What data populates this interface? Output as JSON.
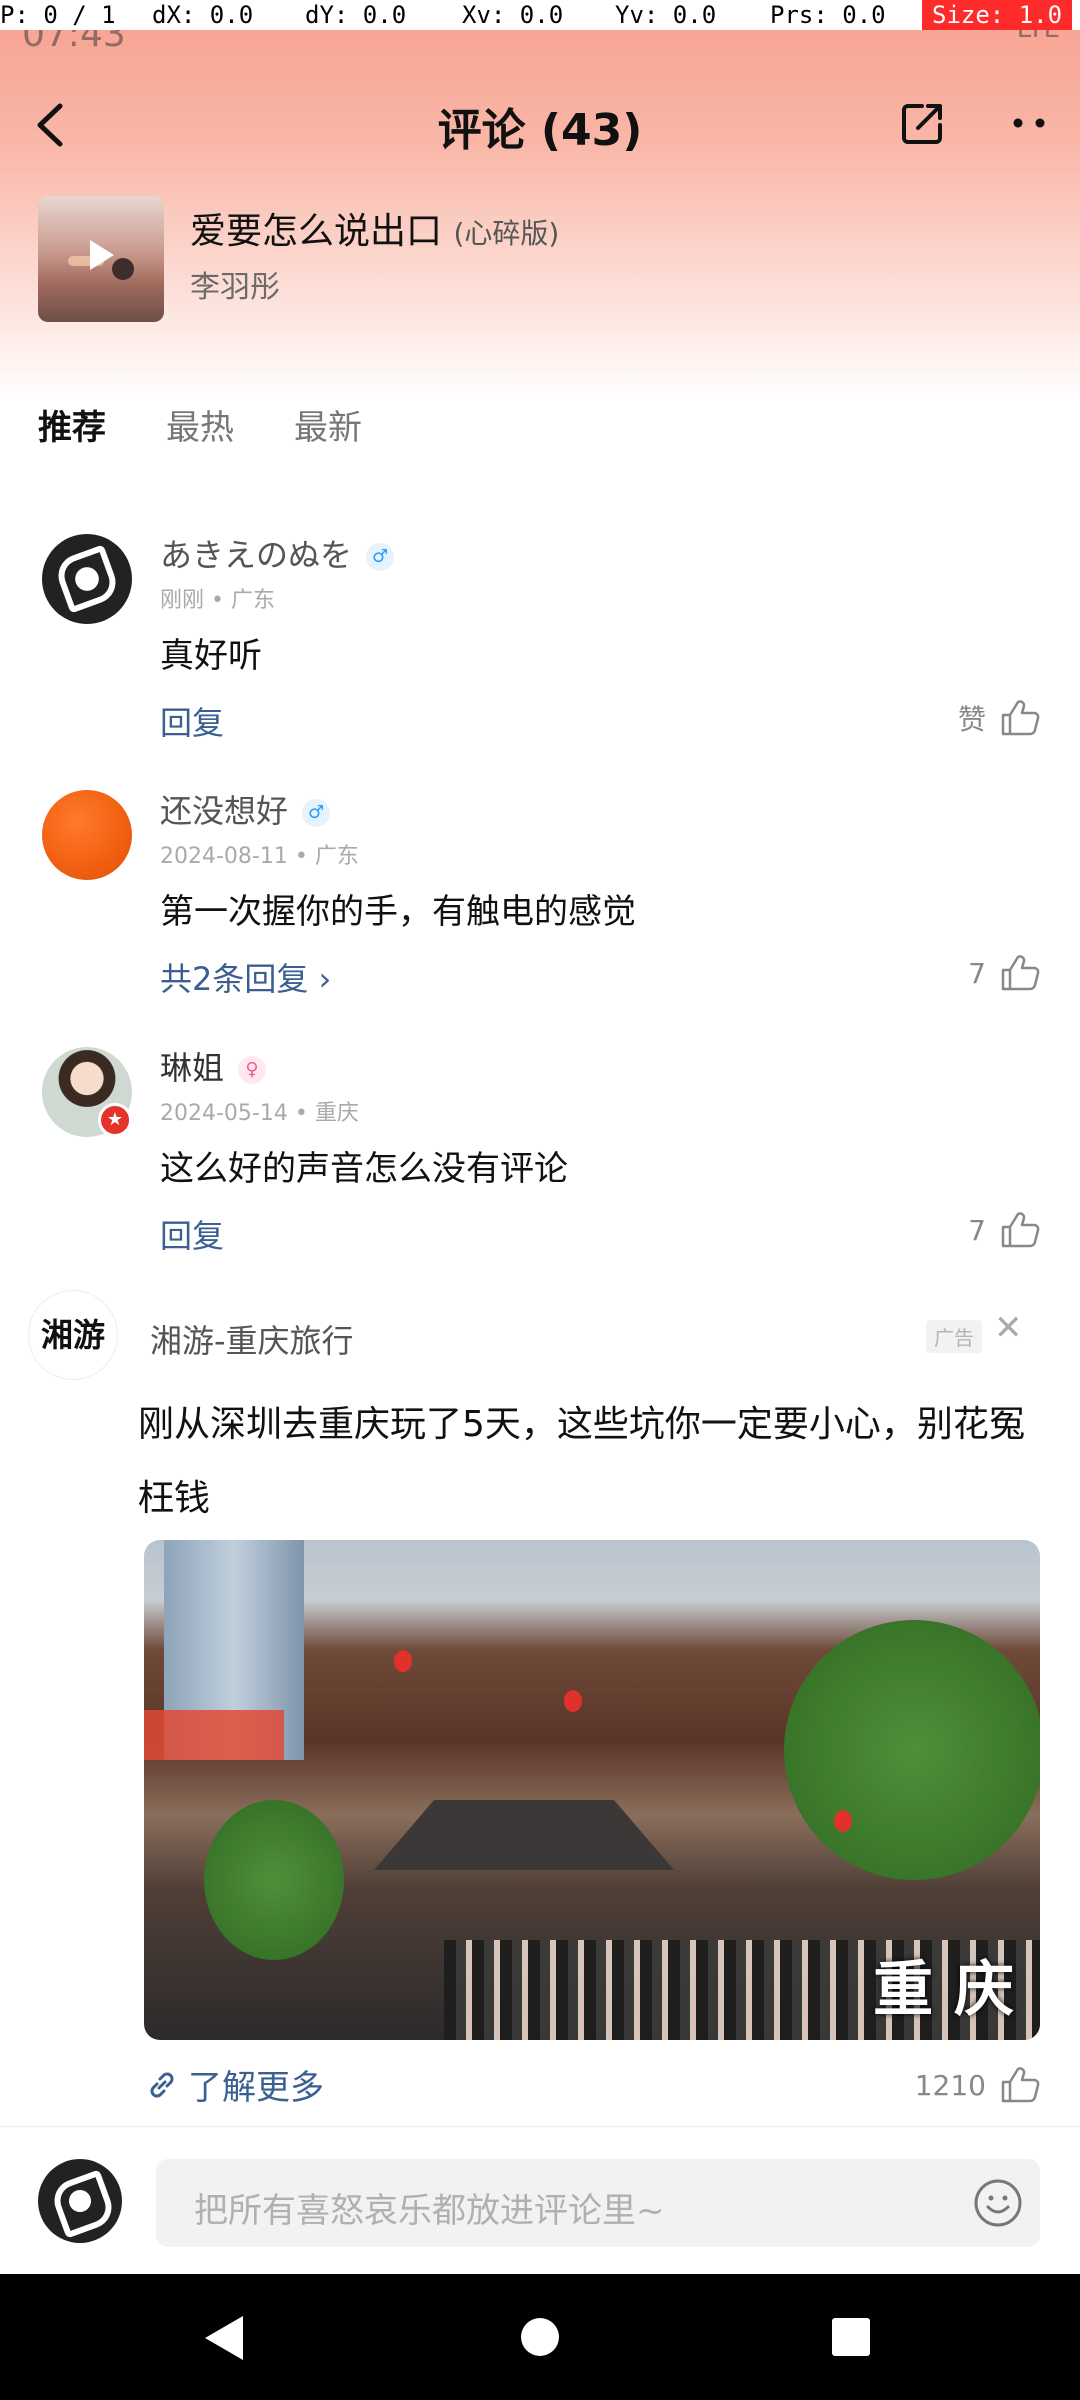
{
  "debug": {
    "p": "P: 0 / 1",
    "dx": "dX: 0.0",
    "dy": "dY: 0.0",
    "xv": "Xv: 0.0",
    "yv": "Yv: 0.0",
    "prs": "Prs: 0.0",
    "size": "Size: 1.0"
  },
  "status": {
    "time": "07:43",
    "network": "LTE"
  },
  "header": {
    "title": "评论 (43)"
  },
  "song": {
    "title": "爱要怎么说出口",
    "tag": "(心碎版)",
    "artist": "李羽彤"
  },
  "tabs": [
    "推荐",
    "最热",
    "最新"
  ],
  "comments": [
    {
      "user": "あきえのぬを",
      "gender": "♂",
      "meta": "刚刚 • 广东",
      "text": "真好听",
      "reply": "回复",
      "likes": "赞"
    },
    {
      "user": "还没想好",
      "gender": "♂",
      "meta": "2024-08-11 • 广东",
      "text": "第一次握你的手，有触电的感觉",
      "reply": "共2条回复 ›",
      "likes": "7"
    },
    {
      "user": "琳姐",
      "gender": "♀",
      "meta": "2024-05-14 • 重庆",
      "text": "这么好的声音怎么没有评论",
      "reply": "回复",
      "likes": "7"
    }
  ],
  "ad": {
    "logo": "湘游",
    "name": "湘游-重庆旅行",
    "tag": "广告",
    "close": "✕",
    "text": "刚从深圳去重庆玩了5天，这些坑你一定要小心，别花冤枉钱",
    "image_caption": "重 庆",
    "link": "了解更多",
    "likes": "1210"
  },
  "composer": {
    "placeholder": "把所有喜怒哀乐都放进评论里~"
  },
  "colors": {
    "accent_link": "#3b5f92",
    "gradient_top": "#f7a08f"
  }
}
